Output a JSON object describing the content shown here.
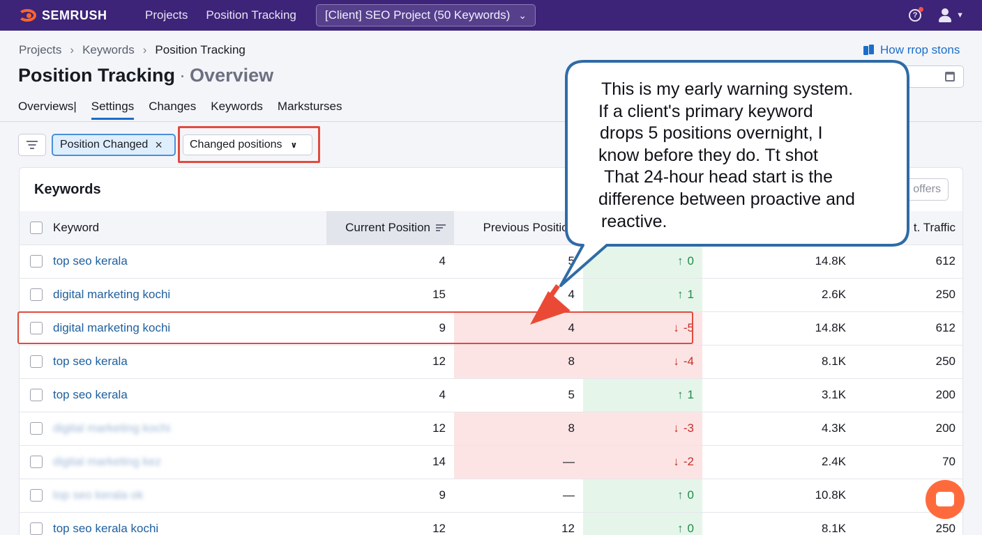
{
  "topbar": {
    "logo_text": "SEMRUSH",
    "nav": [
      "Projects",
      "Position Tracking"
    ],
    "project": "[Client] SEO Project (50 Keywords)"
  },
  "breadcrumb": [
    "Projects",
    "Keywords",
    "Position Tracking"
  ],
  "title": {
    "main": "Position Tracking",
    "sub": "Overview"
  },
  "howto": "How rrop stons",
  "tabs": [
    "Overviews|",
    "Settings",
    "Changes",
    "Keywords",
    "Marksturses"
  ],
  "filters": {
    "chip_label": "Position Changed",
    "select_value": "Changed positions"
  },
  "card": {
    "title": "Keywords",
    "offers_label": "offers",
    "columns": [
      "Keyword",
      "Current Position",
      "Previous Position",
      "",
      "",
      "t. Traffic"
    ],
    "rows": [
      {
        "keyword": "top seo kerala",
        "current": "4",
        "previous": "5",
        "change": "0",
        "dir": "up",
        "volume": "14.8K",
        "traffic": "612"
      },
      {
        "keyword": "digital marketing kochi",
        "current": "15",
        "previous": "4",
        "change": "1",
        "dir": "up",
        "volume": "2.6K",
        "traffic": "250"
      },
      {
        "keyword": "digital marketing kochi",
        "current": "9",
        "previous": "4",
        "change": "-5",
        "dir": "down",
        "volume": "14.8K",
        "traffic": "612"
      },
      {
        "keyword": "top seo kerala",
        "current": "12",
        "previous": "8",
        "change": "-4",
        "dir": "down",
        "volume": "8.1K",
        "traffic": "250"
      },
      {
        "keyword": "top seo kerala",
        "current": "4",
        "previous": "5",
        "change": "1",
        "dir": "up",
        "volume": "3.1K",
        "traffic": "200"
      },
      {
        "keyword": "digital marketing kochi",
        "current": "12",
        "previous": "8",
        "change": "-3",
        "dir": "down",
        "volume": "4.3K",
        "traffic": "200"
      },
      {
        "keyword": "digital marketing kez",
        "current": "14",
        "previous": "—",
        "change": "-2",
        "dir": "down",
        "volume": "2.4K",
        "traffic": "70"
      },
      {
        "keyword": "top seo kerala ok",
        "current": "9",
        "previous": "—",
        "change": "0",
        "dir": "up",
        "volume": "10.8K",
        "traffic": ""
      },
      {
        "keyword": "top seo kerala kochi",
        "current": "12",
        "previous": "12",
        "change": "0",
        "dir": "up",
        "volume": "8.1K",
        "traffic": "250"
      }
    ]
  },
  "callout": {
    "lines": [
      "This is my early warning system.",
      "If a client's primary keyword",
      "drops 5 positions overnight, I",
      "know before they do. Tt shot",
      "That 24-hour head start is the",
      "difference between proactive and",
      "reactive."
    ]
  },
  "icons": {
    "help": "?",
    "chip_close": "×",
    "chevron": "⌄",
    "arrow_up": "↑",
    "arrow_down": "↓",
    "breadcrumb_sep": "›"
  },
  "colors": {
    "brand": "#3d2478",
    "accent": "#ff642d",
    "link": "#1b6ec9",
    "up": "#1f8a4c",
    "down": "#c4302b",
    "highlight": "#e04b3e"
  }
}
